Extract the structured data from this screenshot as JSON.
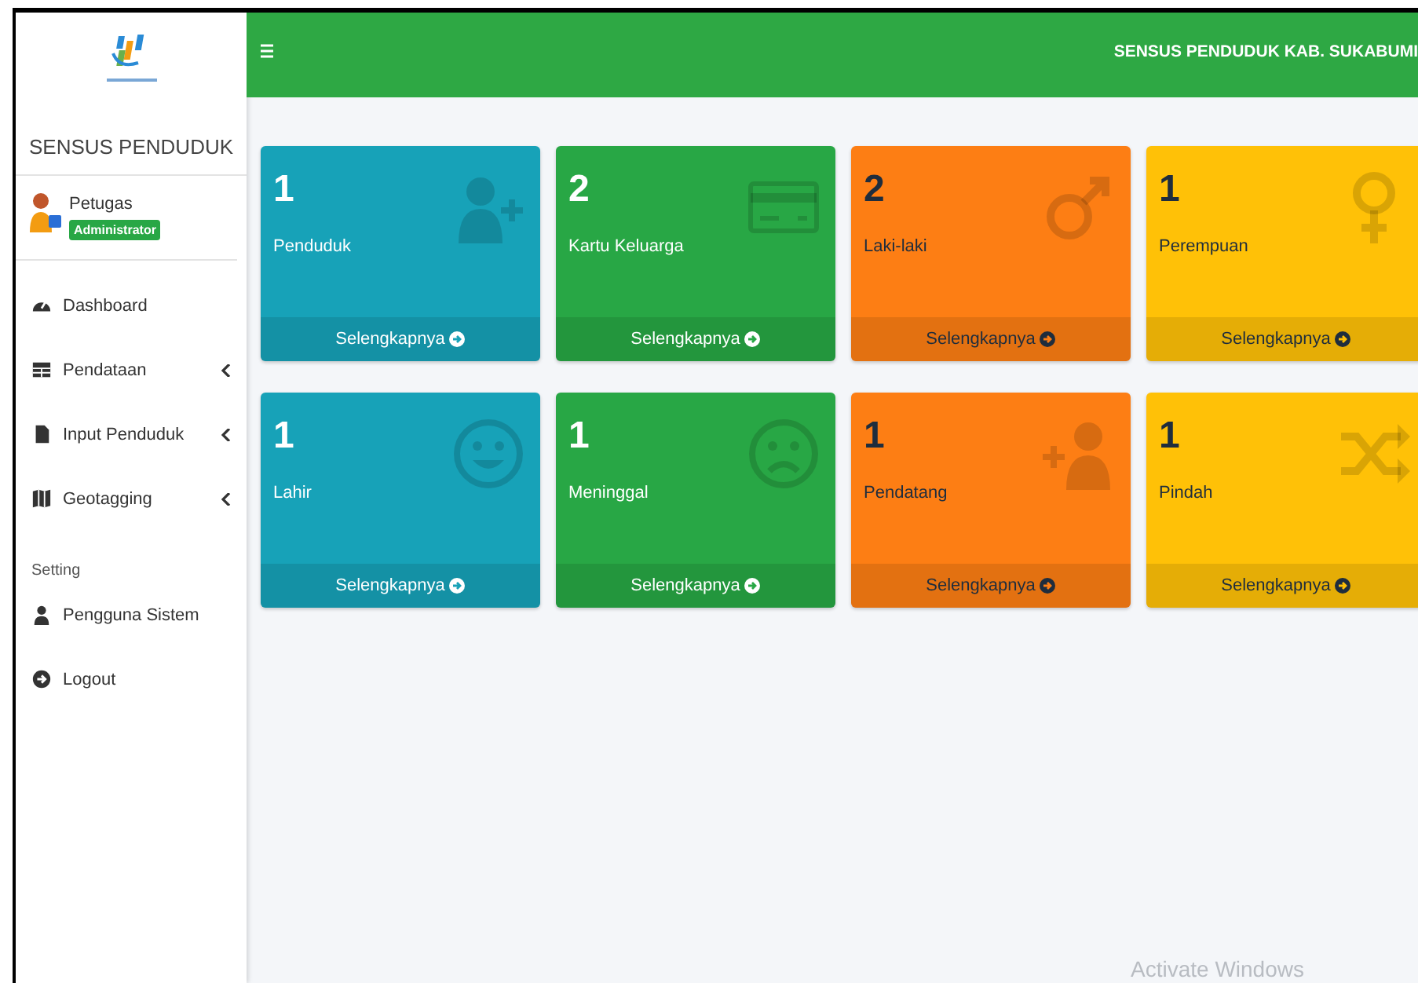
{
  "header": {
    "title": "SENSUS PENDUDUK KAB. SUKABUMI"
  },
  "sidebar": {
    "brand": "SENSUS PENDUDUK",
    "user": {
      "name": "Petugas",
      "role": "Administrator"
    },
    "items": [
      {
        "label": "Dashboard",
        "kind": "link"
      },
      {
        "label": "Pendataan",
        "kind": "submenu",
        "expanded": false
      },
      {
        "label": "Input Penduduk",
        "kind": "submenu",
        "expanded": false
      },
      {
        "label": "Geotagging",
        "kind": "submenu",
        "expanded": false
      }
    ],
    "section": "Setting",
    "setting_items": [
      {
        "label": "Pengguna Sistem"
      },
      {
        "label": "Logout"
      }
    ]
  },
  "cards": [
    {
      "count": "1",
      "label": "Penduduk",
      "link": "Selengkapnya",
      "color": "#17a2b8"
    },
    {
      "count": "2",
      "label": "Kartu Keluarga",
      "link": "Selengkapnya",
      "color": "#28a745"
    },
    {
      "count": "2",
      "label": "Laki-laki",
      "link": "Selengkapnya",
      "color": "#fd7e14"
    },
    {
      "count": "1",
      "label": "Perempuan",
      "link": "Selengkapnya",
      "color": "#ffc107"
    },
    {
      "count": "1",
      "label": "Lahir",
      "link": "Selengkapnya",
      "color": "#17a2b8"
    },
    {
      "count": "1",
      "label": "Meninggal",
      "link": "Selengkapnya",
      "color": "#28a745"
    },
    {
      "count": "1",
      "label": "Pendatang",
      "link": "Selengkapnya",
      "color": "#fd7e14"
    },
    {
      "count": "1",
      "label": "Pindah",
      "link": "Selengkapnya",
      "color": "#ffc107"
    }
  ],
  "os_notice": "Activate Windows"
}
